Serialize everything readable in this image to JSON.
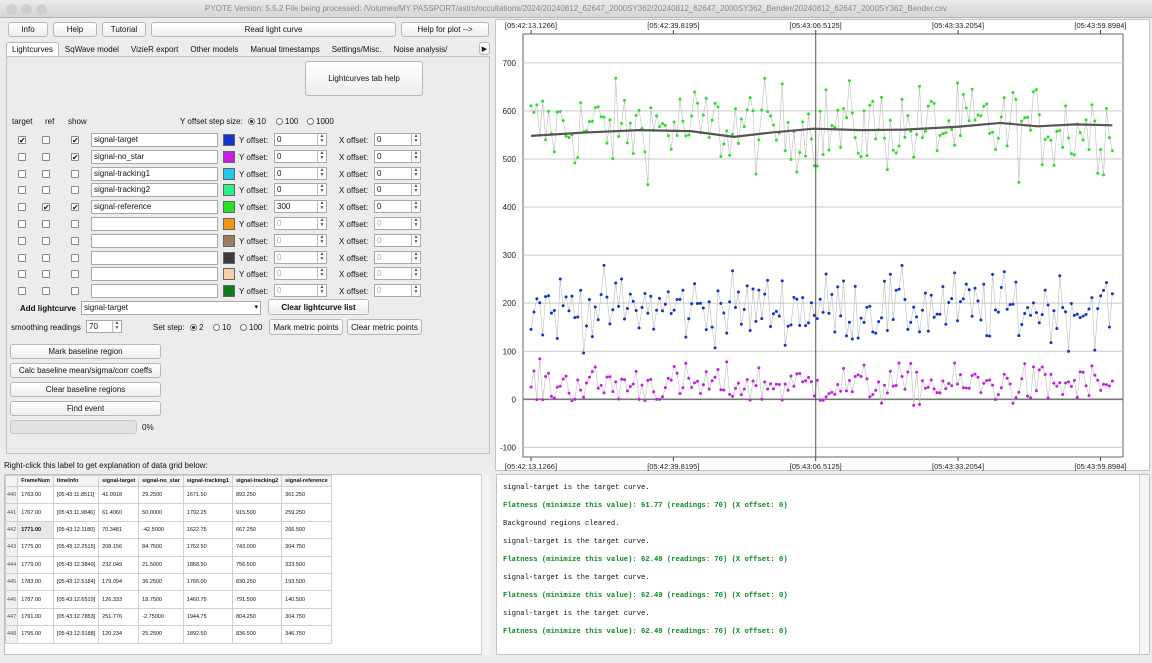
{
  "window": {
    "title": "PYOTE Version: 5.5.2  File being processed: /Volumes/MY PASSPORT/astro/occultations/2024/20240812_62647_2000SY362/20240812_62647_2000SY362_Bender/20240812_62647_2000SY362_Bender.csv"
  },
  "toolbar": {
    "info": "Info",
    "help": "Help",
    "tutorial": "Tutorial",
    "read_light_curve": "Read light curve",
    "help_for_plot": "Help for plot -->"
  },
  "tabs": [
    "Lightcurves",
    "SqWave model",
    "VizieR export",
    "Other models",
    "Manual timestamps",
    "Settings/Misc.",
    "Noise analysis/"
  ],
  "lightcurves": {
    "help_button": "Lightcurves tab help",
    "col_target": "target",
    "col_ref": "ref",
    "col_show": "show",
    "y_step_label": "Y offset step size:",
    "y_step_options": [
      "10",
      "100",
      "1000"
    ],
    "y_offset_label": "Y offset:",
    "x_offset_label": "X offset:",
    "rows": [
      {
        "target": "✔",
        "ref": "",
        "show": "✔",
        "name": "signal-target",
        "color": "#1133cc",
        "yoff": "0",
        "xoff": "0"
      },
      {
        "target": "",
        "ref": "",
        "show": "✔",
        "name": "signal-no_star",
        "color": "#c21fe0",
        "yoff": "0",
        "xoff": "0"
      },
      {
        "target": "",
        "ref": "",
        "show": "",
        "name": "signal-tracking1",
        "color": "#1ec8f0",
        "yoff": "0",
        "xoff": "0"
      },
      {
        "target": "",
        "ref": "",
        "show": "",
        "name": "signal-tracking2",
        "color": "#2df08c",
        "yoff": "0",
        "xoff": "0"
      },
      {
        "target": "",
        "ref": "✔",
        "show": "✔",
        "name": "signal-reference",
        "color": "#2adf2a",
        "yoff": "300",
        "xoff": "0"
      },
      {
        "target": "",
        "ref": "",
        "show": "",
        "name": "",
        "color": "#f2960f",
        "yoff": "0",
        "xoff": "0"
      },
      {
        "target": "",
        "ref": "",
        "show": "",
        "name": "",
        "color": "#a07a5e",
        "yoff": "0",
        "xoff": "0"
      },
      {
        "target": "",
        "ref": "",
        "show": "",
        "name": "",
        "color": "#3a3a3a",
        "yoff": "0",
        "xoff": "0"
      },
      {
        "target": "",
        "ref": "",
        "show": "",
        "name": "",
        "color": "#f7cfa8",
        "yoff": "0",
        "xoff": "0"
      },
      {
        "target": "",
        "ref": "",
        "show": "",
        "name": "",
        "color": "#0d7d18",
        "yoff": "0",
        "xoff": "0"
      }
    ],
    "add_lightcurve_label": "Add lightcurve",
    "add_lightcurve_value": "signal-target",
    "clear_list": "Clear lightcurve list",
    "smoothing_label": "smoothing readings",
    "smoothing_value": "70",
    "set_step_label": "Set step:",
    "set_step_options": [
      "2",
      "10",
      "100"
    ],
    "mark_metric": "Mark metric points",
    "clear_metric": "Clear metric points",
    "mark_baseline": "Mark baseline region",
    "calc_baseline": "Calc baseline mean/sigma/corr coeffs",
    "clear_baseline": "Clear baseline regions",
    "find_event": "Find event",
    "progress": "0%",
    "progress_value": 0
  },
  "grid": {
    "label": "Right-click this label to get explanation of data grid below:",
    "headers": [
      "FrameNum",
      "timeInfo",
      "signal-target",
      "signal-no_star",
      "signal-tracking1",
      "signal-tracking2",
      "signal-reference"
    ],
    "rows": [
      {
        "n": "440",
        "c": [
          "1763.00",
          "[05:43:11.8511]",
          "41.0918",
          "29.2500",
          "1671.50",
          "892.250",
          "361.250"
        ]
      },
      {
        "n": "441",
        "c": [
          "1767.00",
          "[05:43:11.9846]",
          "61.4060",
          "50.0000",
          "1792.25",
          "915.500",
          "259.250"
        ]
      },
      {
        "n": "442",
        "c": [
          "1771.00",
          "[05:43:12.1180]",
          "70.3481",
          "-42.5000",
          "1622.75",
          "667.250",
          "266.500"
        ]
      },
      {
        "n": "443",
        "c": [
          "1775.00",
          "[05:43:12.2515]",
          "208.156",
          "84.7500",
          "1762.50",
          "743.000",
          "304.750"
        ]
      },
      {
        "n": "444",
        "c": [
          "1779.00",
          "[05:43:12.3849]",
          "232.049",
          "21.5000",
          "1868.50",
          "756.500",
          "333.500"
        ]
      },
      {
        "n": "445",
        "c": [
          "1783.00",
          "[05:43:12.5184]",
          "179.094",
          "36.2500",
          "1766.00",
          "830.250",
          "193.500"
        ]
      },
      {
        "n": "446",
        "c": [
          "1787.00",
          "[05:43:12.6519]",
          "126.333",
          "18.7500",
          "1460.75",
          "791.500",
          "140.500"
        ]
      },
      {
        "n": "447",
        "c": [
          "1791.00",
          "[05:43:12.7853]",
          "251.776",
          "-2.75000",
          "1944.75",
          "804.250",
          "304.750"
        ]
      },
      {
        "n": "448",
        "c": [
          "1795.00",
          "[05:43:12.9188]",
          "120.234",
          "25.2500",
          "1892.50",
          "836.500",
          "346.750"
        ]
      }
    ]
  },
  "log": [
    {
      "text": "signal-target is the target curve.",
      "ok": false
    },
    {
      "text": "Flatness (minimize this value): 61.77 (readings: 70) (X offset: 0)",
      "ok": true
    },
    {
      "text": "Background regions cleared.",
      "ok": false
    },
    {
      "text": "signal-target is the target curve.",
      "ok": false
    },
    {
      "text": "Flatness (minimize this value): 62.49 (readings: 70) (X offset: 0)",
      "ok": true
    },
    {
      "text": "signal-target is the target curve.",
      "ok": false
    },
    {
      "text": "Flatness (minimize this value): 62.49 (readings: 70) (X offset: 0)",
      "ok": true
    },
    {
      "text": "signal-target is the target curve.",
      "ok": false
    },
    {
      "text": "Flatness (minimize this value): 62.49 (readings: 70) (X offset: 0)",
      "ok": true
    }
  ],
  "chart_data": {
    "type": "scatter",
    "x_tick_labels": [
      "[05:42:13.1266]",
      "[05:42:39.8195]",
      "[05:43:06.5125]",
      "[05:43:33.2054]",
      "[05:43:59.8984]"
    ],
    "x_tick_seconds": [
      0,
      26.693,
      53.386,
      80.079,
      106.772
    ],
    "xlim": [
      -1.5,
      111
    ],
    "ylim": [
      -120,
      760
    ],
    "y_ticks": [
      -100,
      0,
      100,
      200,
      300,
      400,
      500,
      600,
      700
    ],
    "grid": true,
    "cursor_x": 53.386,
    "series": [
      {
        "color": "#2adf2a",
        "mean": 565,
        "spread": 75,
        "min": 405,
        "max": 760
      },
      {
        "color": "#1133cc",
        "mean": 190,
        "spread": 60,
        "min": -20,
        "max": 360
      },
      {
        "color": "#c21fe0",
        "mean": 30,
        "spread": 35,
        "min": -110,
        "max": 120
      }
    ],
    "smoothed": {
      "color": "#555555",
      "points": [
        [
          0,
          548
        ],
        [
          10,
          555
        ],
        [
          20,
          560
        ],
        [
          30,
          558
        ],
        [
          38,
          546
        ],
        [
          45,
          555
        ],
        [
          53,
          563
        ],
        [
          62,
          560
        ],
        [
          70,
          561
        ],
        [
          80,
          567
        ],
        [
          88,
          575
        ],
        [
          95,
          568
        ],
        [
          102,
          572
        ],
        [
          109,
          570
        ]
      ]
    }
  }
}
